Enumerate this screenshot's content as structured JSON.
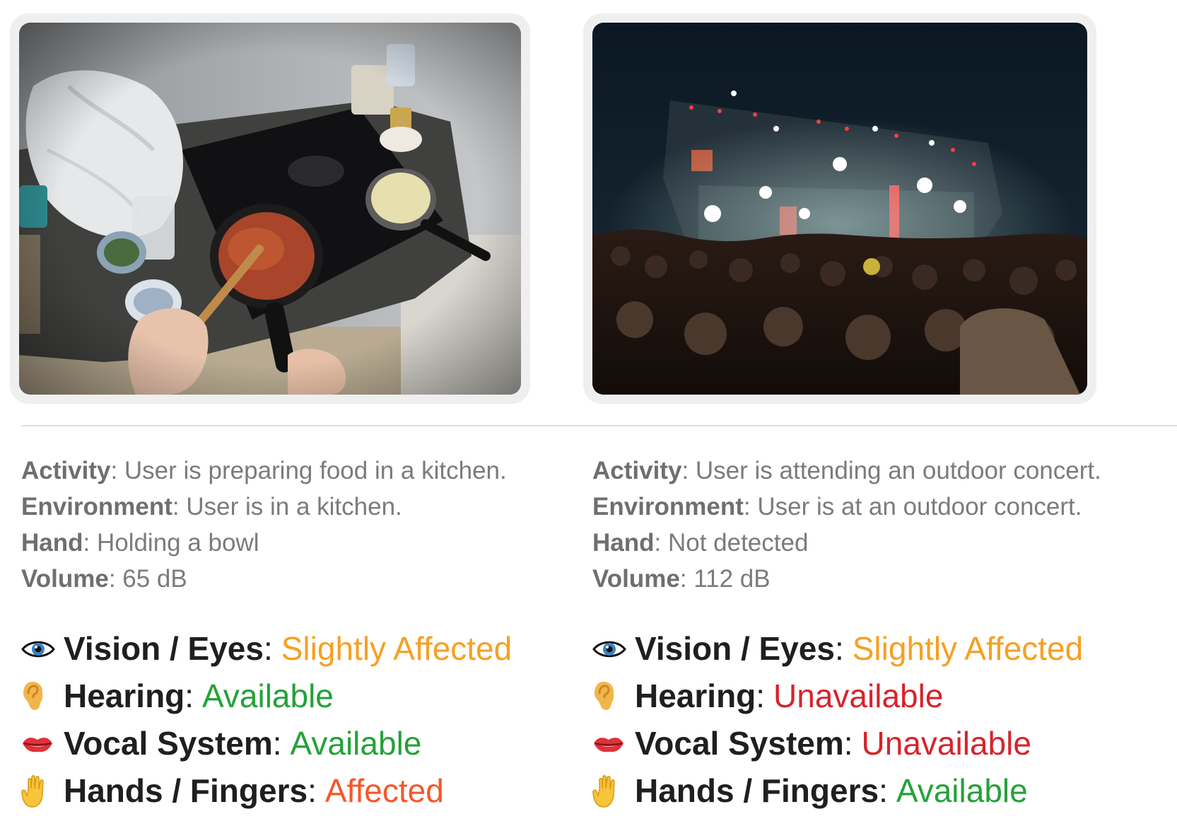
{
  "scenes": [
    {
      "id": "kitchen",
      "context": [
        {
          "key": "Activity",
          "value": "User is preparing food in a kitchen."
        },
        {
          "key": "Environment",
          "value": "User is in a kitchen."
        },
        {
          "key": "Hand",
          "value": "Holding a bowl"
        },
        {
          "key": "Volume",
          "value": "65 dB"
        }
      ],
      "capabilities": [
        {
          "icon": "eye-icon",
          "label": "Vision / Eyes",
          "status": "Slightly Affected",
          "status_color": "#f6a023"
        },
        {
          "icon": "ear-icon",
          "label": "Hearing",
          "status": "Available",
          "status_color": "#23a238"
        },
        {
          "icon": "lips-icon",
          "label": "Vocal System",
          "status": "Available",
          "status_color": "#23a238"
        },
        {
          "icon": "hand-icon",
          "label": "Hands / Fingers",
          "status": "Affected",
          "status_color": "#f5572a"
        }
      ]
    },
    {
      "id": "concert",
      "context": [
        {
          "key": "Activity",
          "value": "User is attending an outdoor concert."
        },
        {
          "key": "Environment",
          "value": "User is at an outdoor concert."
        },
        {
          "key": "Hand",
          "value": "Not detected"
        },
        {
          "key": "Volume",
          "value": "112 dB"
        }
      ],
      "capabilities": [
        {
          "icon": "eye-icon",
          "label": "Vision / Eyes",
          "status": "Slightly Affected",
          "status_color": "#f6a023"
        },
        {
          "icon": "ear-icon",
          "label": "Hearing",
          "status": "Unavailable",
          "status_color": "#d7232b"
        },
        {
          "icon": "lips-icon",
          "label": "Vocal System",
          "status": "Unavailable",
          "status_color": "#d7232b"
        },
        {
          "icon": "hand-icon",
          "label": "Hands / Fingers",
          "status": "Available",
          "status_color": "#23a238"
        }
      ]
    }
  ]
}
